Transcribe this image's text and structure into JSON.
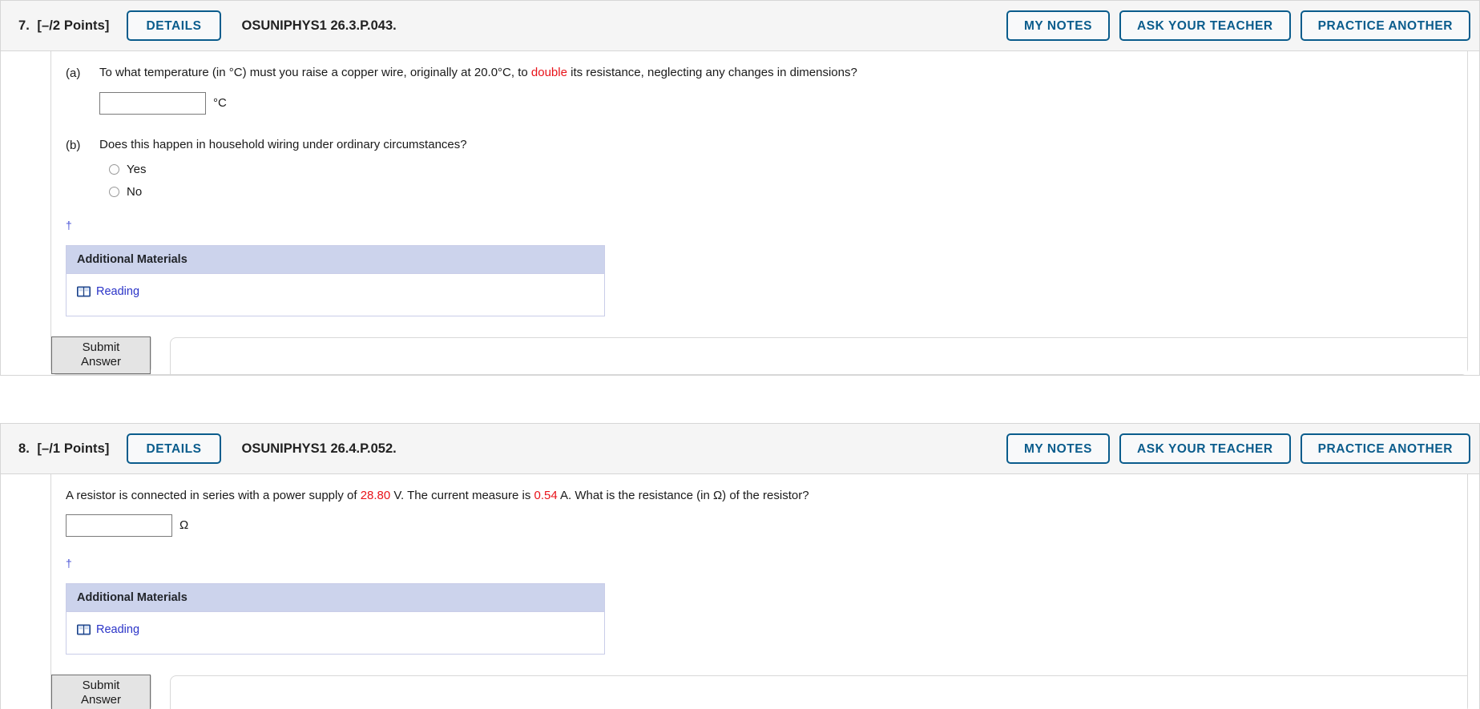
{
  "page": {
    "background": "#ffffff",
    "accent_blue": "#0a5c8c",
    "highlight_red": "#e8131a",
    "link_blue": "#2b34c8",
    "materials_header_bg": "#ccd3ec"
  },
  "questions": [
    {
      "number": "7.",
      "points": "[–/2 Points]",
      "details_label": "DETAILS",
      "code": "OSUNIPHYS1 26.3.P.043.",
      "actions": [
        {
          "label": "MY NOTES",
          "name": "my-notes-button"
        },
        {
          "label": "ASK YOUR TEACHER",
          "name": "ask-your-teacher-button"
        },
        {
          "label": "PRACTICE ANOTHER",
          "name": "practice-another-button"
        }
      ],
      "parts": [
        {
          "label": "(a)",
          "text_before": "To what temperature (in °C) must you raise a copper wire, originally at 20.0°C, to ",
          "highlight": "double",
          "text_after": " its resistance, neglecting any changes in dimensions?",
          "input_value": "",
          "input_placeholder": "",
          "unit": "°C"
        },
        {
          "label": "(b)",
          "text": "Does this happen in household wiring under ordinary circumstances?",
          "options": [
            {
              "label": "Yes",
              "selected": false
            },
            {
              "label": "No",
              "selected": false
            }
          ]
        }
      ],
      "dagger": "†",
      "materials": {
        "title": "Additional Materials",
        "items": [
          {
            "label": "Reading",
            "icon": "open-book-icon"
          }
        ]
      },
      "submit_label": "Submit Answer"
    },
    {
      "number": "8.",
      "points": "[–/1 Points]",
      "details_label": "DETAILS",
      "code": "OSUNIPHYS1 26.4.P.052.",
      "actions": [
        {
          "label": "MY NOTES",
          "name": "my-notes-button"
        },
        {
          "label": "ASK YOUR TEACHER",
          "name": "ask-your-teacher-button"
        },
        {
          "label": "PRACTICE ANOTHER",
          "name": "practice-another-button"
        }
      ],
      "prompt": {
        "seg1": "A resistor is connected in series with a power supply of ",
        "val1": "28.80",
        "seg2": " V. The current measure is ",
        "val2": "0.54",
        "seg3": " A. What is the resistance (in Ω) of the resistor?",
        "input_value": "",
        "input_placeholder": "",
        "unit": "Ω"
      },
      "dagger": "†",
      "materials": {
        "title": "Additional Materials",
        "items": [
          {
            "label": "Reading",
            "icon": "open-book-icon"
          }
        ]
      },
      "submit_label": "Submit Answer"
    }
  ]
}
